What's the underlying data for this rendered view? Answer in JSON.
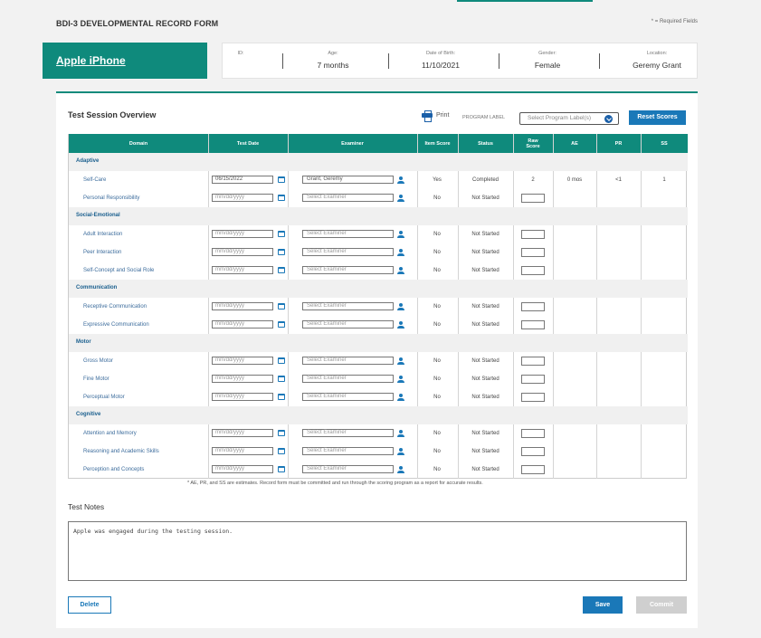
{
  "header": {
    "form_title": "BDI-3 DEVELOPMENTAL RECORD FORM",
    "required_note": "* = Required Fields"
  },
  "student": {
    "name": "Apple iPhone"
  },
  "info": {
    "id_label": "ID:",
    "id_value": "",
    "age_label": "Age:",
    "age_value": "7 months",
    "dob_label": "Date of Birth:",
    "dob_value": "11/10/2021",
    "gender_label": "Gender:",
    "gender_value": "Female",
    "location_label": "Location:",
    "location_value": "Geremy Grant"
  },
  "overview": {
    "title": "Test Session Overview",
    "print_label": "Print",
    "program_label": "PROGRAM LABEL",
    "program_placeholder": "Select Program Label(s)",
    "reset_label": "Reset Scores"
  },
  "table": {
    "headers": {
      "domain": "Domain",
      "test_date": "Test Date",
      "examiner": "Examiner",
      "item_score": "Item Score",
      "status": "Status",
      "raw_score": "Raw Score",
      "ae": "AE",
      "pr": "PR",
      "ss": "SS"
    },
    "domains": [
      {
        "name": "Adaptive",
        "subs": [
          {
            "name": "Self-Care",
            "date": "06/15/2022",
            "examiner": "Grant, Geremy",
            "item": "Yes",
            "status": "Completed",
            "raw": "2",
            "ae": "0 mos",
            "pr": "<1",
            "ss": "1"
          },
          {
            "name": "Personal Responsibility",
            "date": "",
            "examiner": "",
            "item": "No",
            "status": "Not Started",
            "raw": "",
            "ae": "",
            "pr": "",
            "ss": ""
          }
        ]
      },
      {
        "name": "Social-Emotional",
        "subs": [
          {
            "name": "Adult Interaction",
            "date": "",
            "examiner": "",
            "item": "No",
            "status": "Not Started",
            "raw": "",
            "ae": "",
            "pr": "",
            "ss": ""
          },
          {
            "name": "Peer Interaction",
            "date": "",
            "examiner": "",
            "item": "No",
            "status": "Not Started",
            "raw": "",
            "ae": "",
            "pr": "",
            "ss": ""
          },
          {
            "name": "Self-Concept and Social Role",
            "date": "",
            "examiner": "",
            "item": "No",
            "status": "Not Started",
            "raw": "",
            "ae": "",
            "pr": "",
            "ss": ""
          }
        ]
      },
      {
        "name": "Communication",
        "subs": [
          {
            "name": "Receptive Communication",
            "date": "",
            "examiner": "",
            "item": "No",
            "status": "Not Started",
            "raw": "",
            "ae": "",
            "pr": "",
            "ss": ""
          },
          {
            "name": "Expressive Communication",
            "date": "",
            "examiner": "",
            "item": "No",
            "status": "Not Started",
            "raw": "",
            "ae": "",
            "pr": "",
            "ss": ""
          }
        ]
      },
      {
        "name": "Motor",
        "subs": [
          {
            "name": "Gross Motor",
            "date": "",
            "examiner": "",
            "item": "No",
            "status": "Not Started",
            "raw": "",
            "ae": "",
            "pr": "",
            "ss": ""
          },
          {
            "name": "Fine Motor",
            "date": "",
            "examiner": "",
            "item": "No",
            "status": "Not Started",
            "raw": "",
            "ae": "",
            "pr": "",
            "ss": ""
          },
          {
            "name": "Perceptual Motor",
            "date": "",
            "examiner": "",
            "item": "No",
            "status": "Not Started",
            "raw": "",
            "ae": "",
            "pr": "",
            "ss": ""
          }
        ]
      },
      {
        "name": "Cognitive",
        "subs": [
          {
            "name": "Attention and Memory",
            "date": "",
            "examiner": "",
            "item": "No",
            "status": "Not Started",
            "raw": "",
            "ae": "",
            "pr": "",
            "ss": ""
          },
          {
            "name": "Reasoning and Academic Skills",
            "date": "",
            "examiner": "",
            "item": "No",
            "status": "Not Started",
            "raw": "",
            "ae": "",
            "pr": "",
            "ss": ""
          },
          {
            "name": "Perception and Concepts",
            "date": "",
            "examiner": "",
            "item": "No",
            "status": "Not Started",
            "raw": "",
            "ae": "",
            "pr": "",
            "ss": ""
          }
        ]
      }
    ],
    "date_placeholder": "mm/dd/yyyy",
    "examiner_placeholder": "Select Examiner",
    "note": "* AE, PR, and SS are estimates. Record form must be committed and run through the scoring program as a report for accurate results."
  },
  "notes": {
    "title": "Test Notes",
    "text": "Apple was engaged during the testing session."
  },
  "actions": {
    "delete_label": "Delete",
    "save_label": "Save",
    "commit_label": "Commit"
  },
  "colors": {
    "teal": "#0f8a7c",
    "blue": "#1a78b8",
    "disabled": "#cfcfcf"
  }
}
